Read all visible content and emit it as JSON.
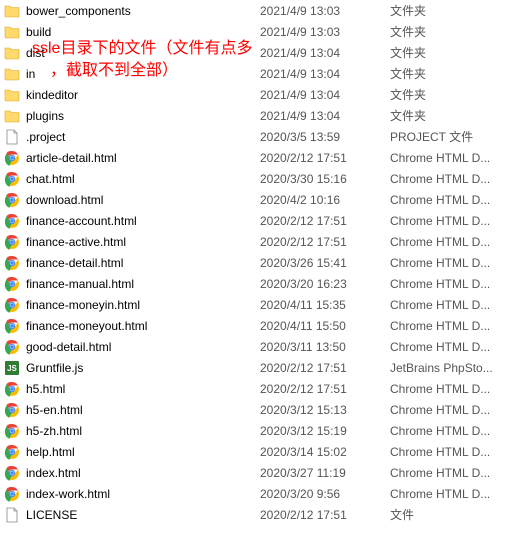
{
  "annotation": {
    "line1": "ssle目录下的文件（文件有点多",
    "line2": "，截取不到全部）"
  },
  "files": [
    {
      "icon": "folder",
      "name": "bower_components",
      "date": "2021/4/9 13:03",
      "type": "文件夹"
    },
    {
      "icon": "folder",
      "name": "build",
      "date": "2021/4/9 13:03",
      "type": "文件夹"
    },
    {
      "icon": "folder",
      "name": "dist",
      "date": "2021/4/9 13:04",
      "type": "文件夹"
    },
    {
      "icon": "folder",
      "name": "in",
      "date": "2021/4/9 13:04",
      "type": "文件夹"
    },
    {
      "icon": "folder",
      "name": "kindeditor",
      "date": "2021/4/9 13:04",
      "type": "文件夹"
    },
    {
      "icon": "folder",
      "name": "plugins",
      "date": "2021/4/9 13:04",
      "type": "文件夹"
    },
    {
      "icon": "file",
      "name": ".project",
      "date": "2020/3/5 13:59",
      "type": "PROJECT 文件"
    },
    {
      "icon": "chrome",
      "name": "article-detail.html",
      "date": "2020/2/12 17:51",
      "type": "Chrome HTML D..."
    },
    {
      "icon": "chrome",
      "name": "chat.html",
      "date": "2020/3/30 15:16",
      "type": "Chrome HTML D..."
    },
    {
      "icon": "chrome",
      "name": "download.html",
      "date": "2020/4/2 10:16",
      "type": "Chrome HTML D..."
    },
    {
      "icon": "chrome",
      "name": "finance-account.html",
      "date": "2020/2/12 17:51",
      "type": "Chrome HTML D..."
    },
    {
      "icon": "chrome",
      "name": "finance-active.html",
      "date": "2020/2/12 17:51",
      "type": "Chrome HTML D..."
    },
    {
      "icon": "chrome",
      "name": "finance-detail.html",
      "date": "2020/3/26 15:41",
      "type": "Chrome HTML D..."
    },
    {
      "icon": "chrome",
      "name": "finance-manual.html",
      "date": "2020/3/20 16:23",
      "type": "Chrome HTML D..."
    },
    {
      "icon": "chrome",
      "name": "finance-moneyin.html",
      "date": "2020/4/11 15:35",
      "type": "Chrome HTML D..."
    },
    {
      "icon": "chrome",
      "name": "finance-moneyout.html",
      "date": "2020/4/11 15:50",
      "type": "Chrome HTML D..."
    },
    {
      "icon": "chrome",
      "name": "good-detail.html",
      "date": "2020/3/11 13:50",
      "type": "Chrome HTML D..."
    },
    {
      "icon": "js",
      "name": "Gruntfile.js",
      "date": "2020/2/12 17:51",
      "type": "JetBrains PhpSto..."
    },
    {
      "icon": "chrome",
      "name": "h5.html",
      "date": "2020/2/12 17:51",
      "type": "Chrome HTML D..."
    },
    {
      "icon": "chrome",
      "name": "h5-en.html",
      "date": "2020/3/12 15:13",
      "type": "Chrome HTML D..."
    },
    {
      "icon": "chrome",
      "name": "h5-zh.html",
      "date": "2020/3/12 15:19",
      "type": "Chrome HTML D..."
    },
    {
      "icon": "chrome",
      "name": "help.html",
      "date": "2020/3/14 15:02",
      "type": "Chrome HTML D..."
    },
    {
      "icon": "chrome",
      "name": "index.html",
      "date": "2020/3/27 11:19",
      "type": "Chrome HTML D..."
    },
    {
      "icon": "chrome",
      "name": "index-work.html",
      "date": "2020/3/20 9:56",
      "type": "Chrome HTML D..."
    },
    {
      "icon": "file",
      "name": "LICENSE",
      "date": "2020/2/12 17:51",
      "type": "文件"
    }
  ],
  "icons": {
    "folder": "folder-icon",
    "file": "file-icon",
    "chrome": "chrome-icon",
    "js": "js-icon"
  }
}
